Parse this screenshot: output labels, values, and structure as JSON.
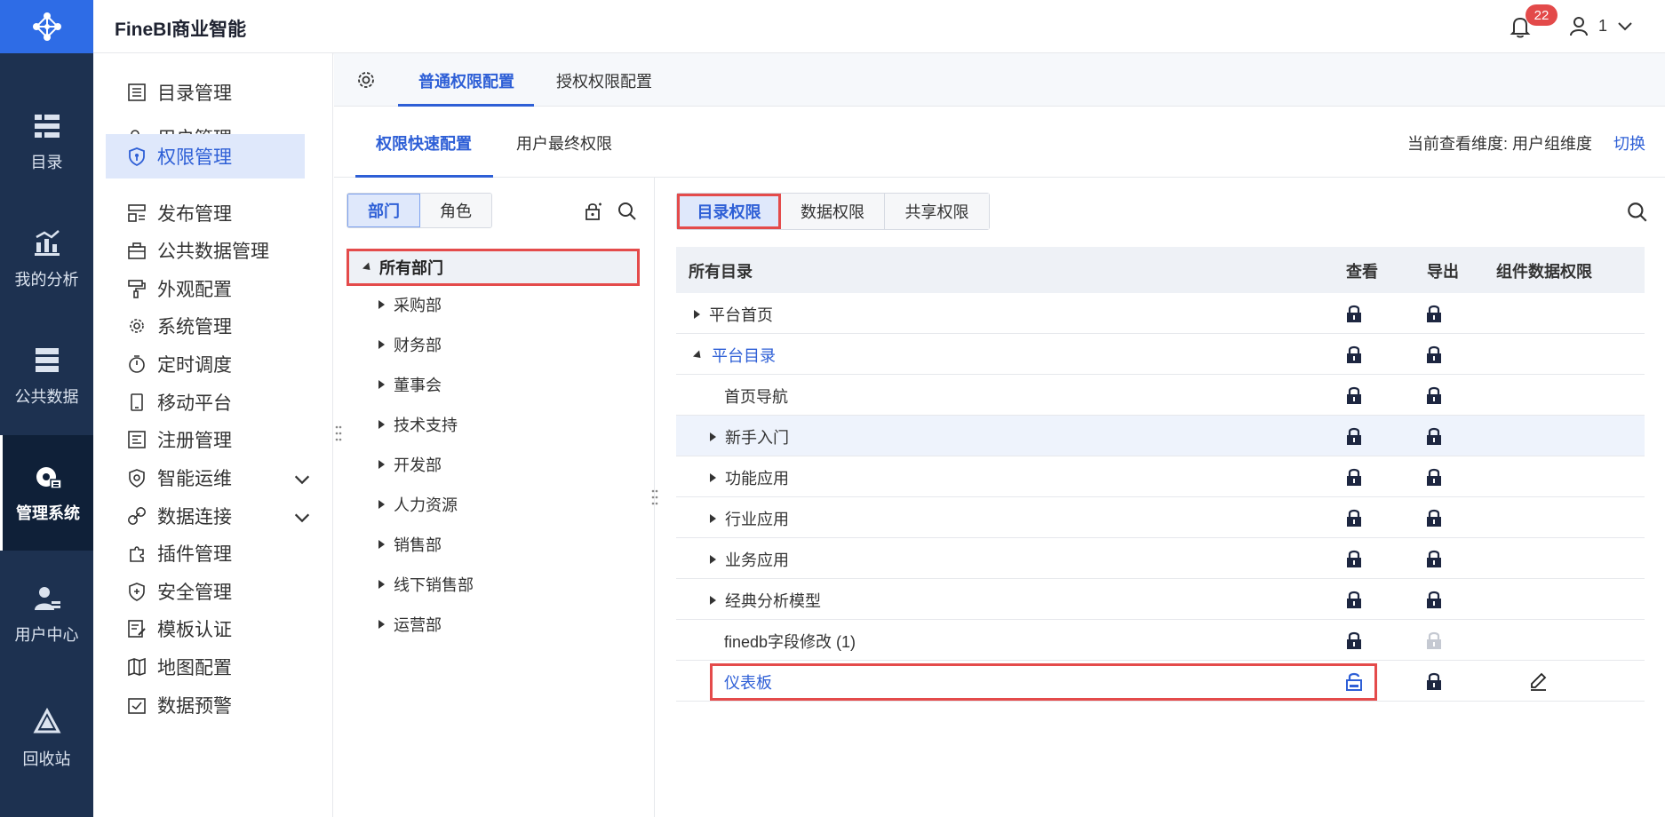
{
  "app": {
    "brand": "FineBI商业智能",
    "notification_count": "22",
    "user_name": "1"
  },
  "colors": {
    "primary": "#2e5fd6",
    "nav_bg": "#1d3150",
    "highlight_red": "#e44b4b",
    "badge": "#e34a4a"
  },
  "leftnav": [
    {
      "label": "目录",
      "icon": "catalog-icon"
    },
    {
      "label": "我的分析",
      "icon": "analysis-icon"
    },
    {
      "label": "公共数据",
      "icon": "public-data-icon"
    },
    {
      "label": "管理系统",
      "icon": "admin-system-icon",
      "active": true
    },
    {
      "label": "用户中心",
      "icon": "user-center-icon"
    },
    {
      "label": "回收站",
      "icon": "recycle-bin-icon"
    }
  ],
  "submenu": [
    {
      "label": "目录管理",
      "icon": "list-icon"
    },
    {
      "label": "用户管理",
      "icon": "user-icon"
    },
    {
      "label": "权限管理",
      "icon": "shield-icon",
      "active": true
    },
    {
      "label": "发布管理",
      "icon": "publish-icon"
    },
    {
      "label": "公共数据管理",
      "icon": "public-data-manage-icon"
    },
    {
      "label": "外观配置",
      "icon": "paint-roller-icon"
    },
    {
      "label": "系统管理",
      "icon": "gear-icon"
    },
    {
      "label": "定时调度",
      "icon": "stopwatch-icon"
    },
    {
      "label": "移动平台",
      "icon": "mobile-icon"
    },
    {
      "label": "注册管理",
      "icon": "register-icon"
    },
    {
      "label": "智能运维",
      "icon": "ops-icon",
      "expandable": true
    },
    {
      "label": "数据连接",
      "icon": "link-icon",
      "expandable": true
    },
    {
      "label": "插件管理",
      "icon": "plugin-icon"
    },
    {
      "label": "安全管理",
      "icon": "security-icon"
    },
    {
      "label": "模板认证",
      "icon": "template-cert-icon"
    },
    {
      "label": "地图配置",
      "icon": "map-icon"
    },
    {
      "label": "数据预警",
      "icon": "alert-icon"
    }
  ],
  "tabs_top": {
    "first": "普通权限配置",
    "second": "授权权限配置"
  },
  "tabs_second": {
    "first": "权限快速配置",
    "second": "用户最终权限"
  },
  "dimension": {
    "label": "当前查看维度:  用户组维度",
    "switch": "切换"
  },
  "tree": {
    "segment": {
      "dept": "部门",
      "role": "角色"
    },
    "root": "所有部门",
    "nodes": [
      "采购部",
      "财务部",
      "董事会",
      "技术支持",
      "开发部",
      "人力资源",
      "销售部",
      "线下销售部",
      "运营部"
    ]
  },
  "perm": {
    "segment": {
      "catalog": "目录权限",
      "data": "数据权限",
      "share": "共享权限"
    },
    "headers": {
      "name": "所有目录",
      "view": "查看",
      "export": "导出",
      "component": "组件数据权限"
    },
    "rows": [
      {
        "name": "平台首页"
      },
      {
        "name": "平台目录"
      },
      {
        "name": "首页导航"
      },
      {
        "name": "新手入门"
      },
      {
        "name": "功能应用"
      },
      {
        "name": "行业应用"
      },
      {
        "name": "业务应用"
      },
      {
        "name": "经典分析模型"
      },
      {
        "name": "finedb字段修改 (1)"
      },
      {
        "name": "仪表板"
      }
    ]
  }
}
